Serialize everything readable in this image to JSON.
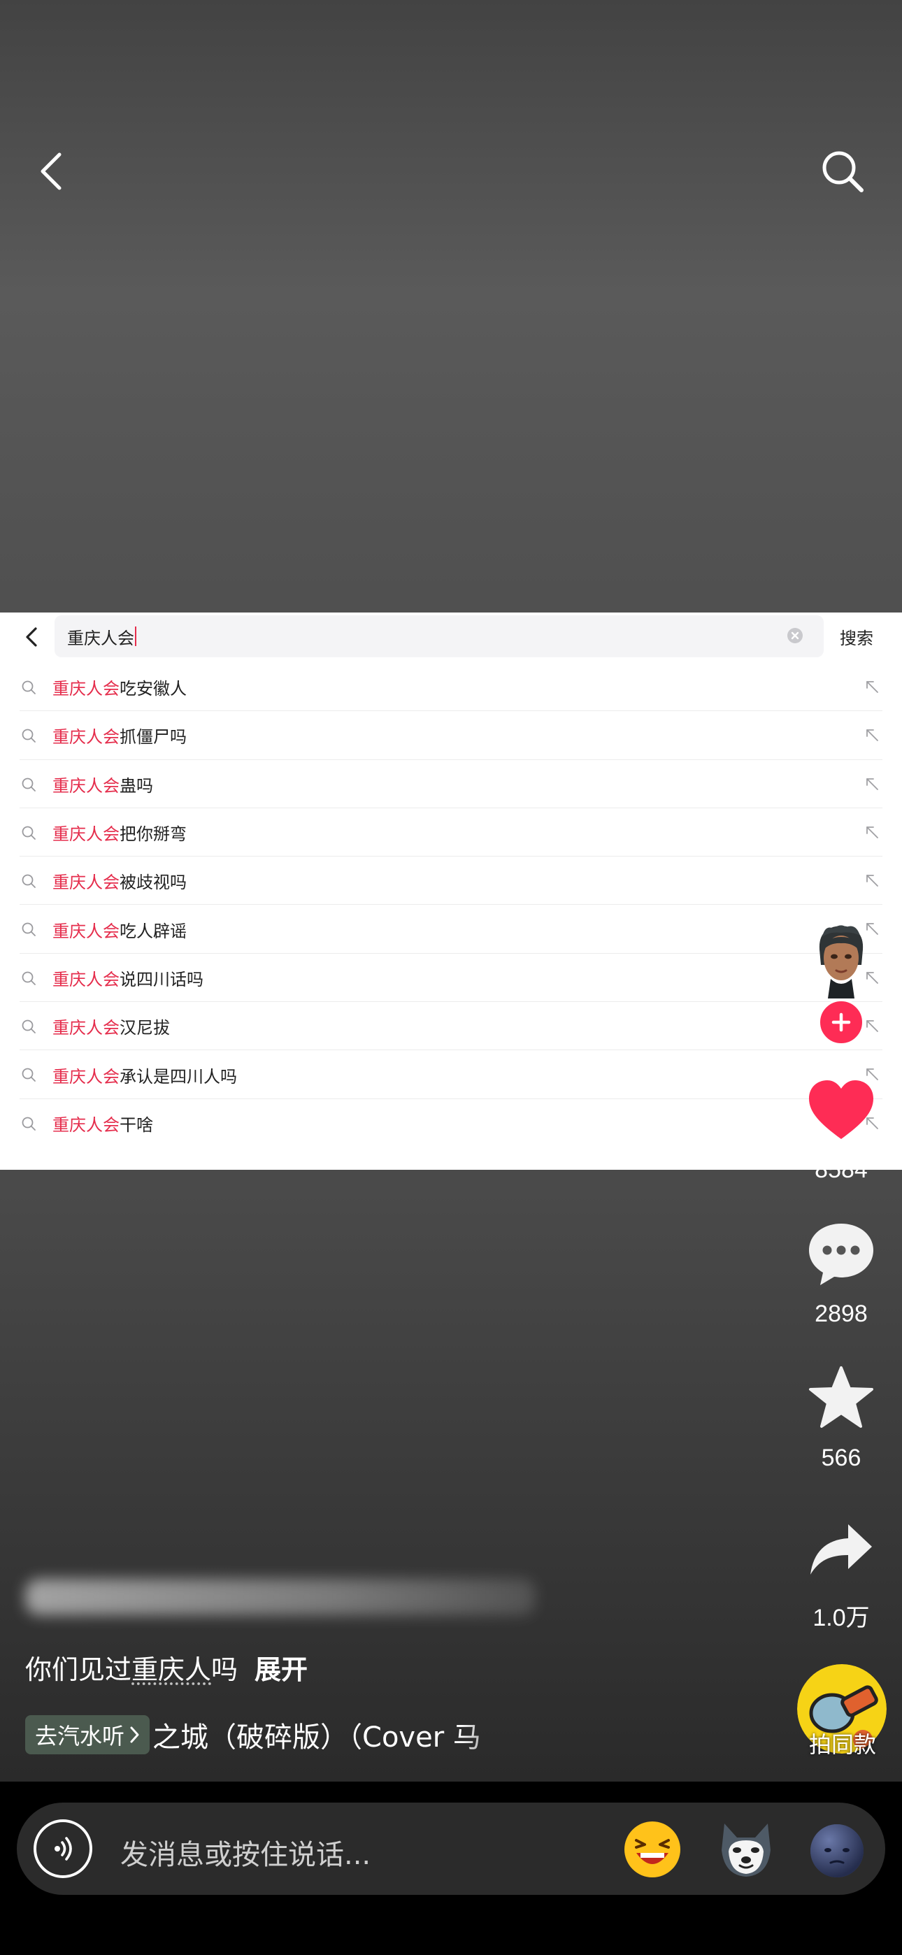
{
  "top_bar": {
    "back_icon": "chevron-left-icon",
    "search_icon": "search-icon"
  },
  "search_panel": {
    "query_text": "重庆人会",
    "submit_label": "搜索",
    "clear_icon": "clear-circle-icon",
    "suggestions": [
      {
        "highlight": "重庆人会",
        "rest": "吃安徽人"
      },
      {
        "highlight": "重庆人会",
        "rest": "抓僵尸吗"
      },
      {
        "highlight": "重庆人会",
        "rest": "蛊吗"
      },
      {
        "highlight": "重庆人会",
        "rest": "把你掰弯"
      },
      {
        "highlight": "重庆人会",
        "rest": "被歧视吗"
      },
      {
        "highlight": "重庆人会",
        "rest": "吃人辟谣"
      },
      {
        "highlight": "重庆人会",
        "rest": "说四川话吗"
      },
      {
        "highlight": "重庆人会",
        "rest": "汉尼拔"
      },
      {
        "highlight": "重庆人会",
        "rest": "承认是四川人吗"
      },
      {
        "highlight": "重庆人会",
        "rest": "干啥"
      }
    ]
  },
  "rail": {
    "likes": "8584",
    "comments": "2898",
    "favorites": "566",
    "shares": "1.0万",
    "same_style_label": "拍同款"
  },
  "caption": {
    "text_before": "你们见过",
    "tag": "重庆人",
    "text_after": "吗",
    "expand": "展开"
  },
  "music": {
    "go_listen_label": "去汽水听",
    "title": "之城（破碎版）（Cover 马"
  },
  "message_bar": {
    "placeholder": "发消息或按住说话...",
    "emojis": [
      "laughing-emoji-icon",
      "husky-sticker-icon",
      "dark-moon-face-icon"
    ]
  },
  "colors": {
    "accent": "#fe2c55",
    "highlight": "#e52d4c",
    "like": "#fe2c55"
  }
}
